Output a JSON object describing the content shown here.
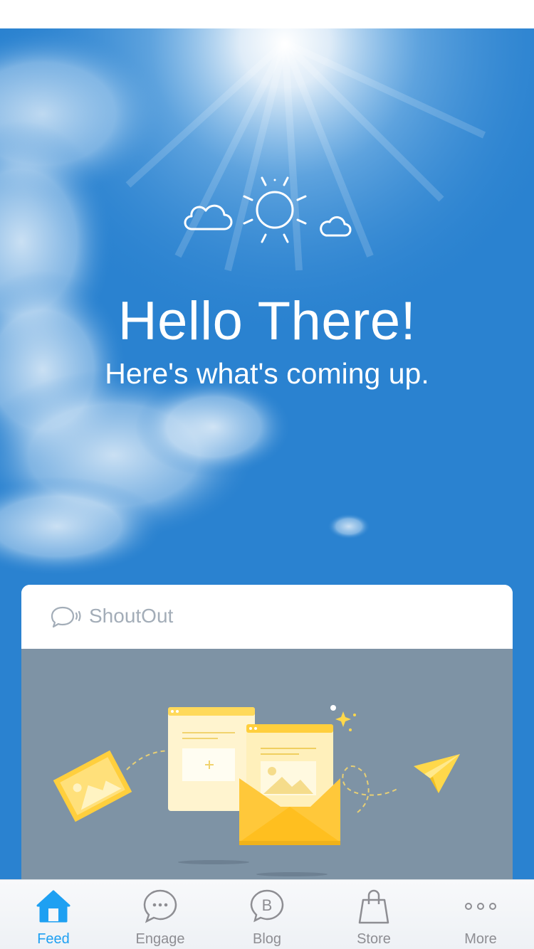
{
  "hero": {
    "title": "Hello There!",
    "subtitle": "Here's what's coming up.",
    "background_color": "#2a82d0",
    "weather_icon": "sun-with-clouds-icon"
  },
  "card": {
    "title": "ShoutOut",
    "icon": "speech-bubble-icon",
    "illustration_bg": "#7e93a5"
  },
  "tabs": [
    {
      "label": "Feed",
      "icon": "home-icon",
      "active": true
    },
    {
      "label": "Engage",
      "icon": "chat-bubble-icon",
      "active": false
    },
    {
      "label": "Blog",
      "icon": "blog-icon",
      "active": false
    },
    {
      "label": "Store",
      "icon": "shopping-bag-icon",
      "active": false
    },
    {
      "label": "More",
      "icon": "more-dots-icon",
      "active": false
    }
  ],
  "colors": {
    "accent": "#1ea0f2",
    "inactive": "#8e8e93"
  }
}
